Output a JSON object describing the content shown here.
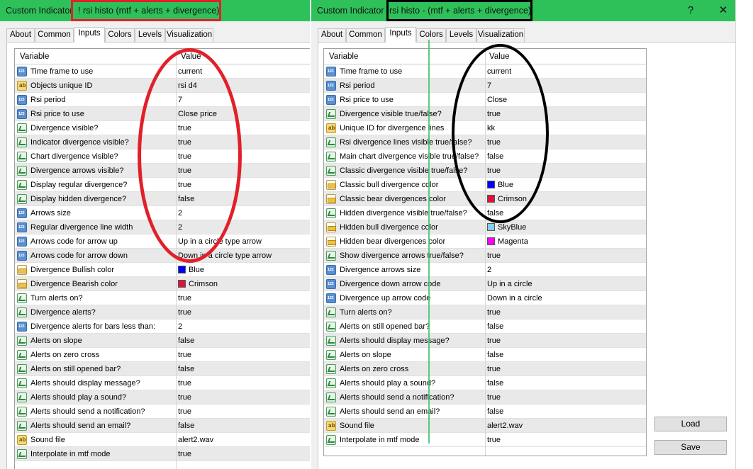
{
  "left": {
    "title_prefix": "Custom Indicator",
    "title_name": "! rsi histo (mtf + alerts + divergence)",
    "tabs": [
      "About",
      "Common",
      "Inputs",
      "Colors",
      "Levels",
      "Visualization"
    ],
    "header": {
      "variable": "Variable",
      "value": "Value"
    },
    "rows": [
      {
        "icon": "num",
        "variable": "Time frame to use",
        "value": "current"
      },
      {
        "icon": "str",
        "variable": "Objects unique ID",
        "value": "rsi d4"
      },
      {
        "icon": "num",
        "variable": "Rsi period",
        "value": "7"
      },
      {
        "icon": "num",
        "variable": "Rsi price to use",
        "value": "Close price"
      },
      {
        "icon": "bool",
        "variable": "Divergence visible?",
        "value": "true"
      },
      {
        "icon": "bool",
        "variable": "Indicator divergence visible?",
        "value": "true"
      },
      {
        "icon": "bool",
        "variable": "Chart divergence visible?",
        "value": "true"
      },
      {
        "icon": "bool",
        "variable": "Divergence arrows visible?",
        "value": "true"
      },
      {
        "icon": "bool",
        "variable": "Display regular divergence?",
        "value": "true"
      },
      {
        "icon": "bool",
        "variable": "Display hidden divergence?",
        "value": "false"
      },
      {
        "icon": "num",
        "variable": "Arrows size",
        "value": "2"
      },
      {
        "icon": "num",
        "variable": "Regular divergence line width",
        "value": "2"
      },
      {
        "icon": "num",
        "variable": "Arrows code for arrow up",
        "value": "Up in a circle type arrow"
      },
      {
        "icon": "num",
        "variable": "Arrows code for arrow down",
        "value": "Down in a circle type arrow"
      },
      {
        "icon": "col",
        "variable": "Divergence Bullish color",
        "value": "Blue",
        "swatch": "#0000ff"
      },
      {
        "icon": "col",
        "variable": "Divergence Bearish color",
        "value": "Crimson",
        "swatch": "#dc143c"
      },
      {
        "icon": "bool",
        "variable": "Turn alerts on?",
        "value": "true"
      },
      {
        "icon": "bool",
        "variable": "Divergence alerts?",
        "value": "true"
      },
      {
        "icon": "num",
        "variable": "Divergence alerts for bars less than:",
        "value": "2"
      },
      {
        "icon": "bool",
        "variable": "Alerts on slope",
        "value": "false"
      },
      {
        "icon": "bool",
        "variable": "Alerts on zero cross",
        "value": "true"
      },
      {
        "icon": "bool",
        "variable": "Alerts on still opened bar?",
        "value": "false"
      },
      {
        "icon": "bool",
        "variable": "Alerts should display message?",
        "value": "true"
      },
      {
        "icon": "bool",
        "variable": "Alerts should play a sound?",
        "value": "true"
      },
      {
        "icon": "bool",
        "variable": "Alerts should send a notification?",
        "value": "true"
      },
      {
        "icon": "bool",
        "variable": "Alerts should send an email?",
        "value": "false"
      },
      {
        "icon": "str",
        "variable": "Sound file",
        "value": "alert2.wav"
      },
      {
        "icon": "bool",
        "variable": "Interpolate in mtf mode",
        "value": "true"
      }
    ]
  },
  "right": {
    "title_prefix": "Custom Indicator",
    "title_name": "rsi histo - (mtf + alerts + divergence)",
    "help_label": "?",
    "close_label": "✕",
    "tabs": [
      "About",
      "Common",
      "Inputs",
      "Colors",
      "Levels",
      "Visualization"
    ],
    "header": {
      "variable": "Variable",
      "value": "Value"
    },
    "rows": [
      {
        "icon": "num",
        "variable": "Time frame to use",
        "value": "current"
      },
      {
        "icon": "num",
        "variable": "Rsi period",
        "value": "7"
      },
      {
        "icon": "num",
        "variable": "Rsi price to use",
        "value": "Close"
      },
      {
        "icon": "bool",
        "variable": "Divergence visible true/false?",
        "value": "true"
      },
      {
        "icon": "str",
        "variable": "Unique ID for divergence lines",
        "value": "kk"
      },
      {
        "icon": "bool",
        "variable": "Rsi divergence lines visible true/false?",
        "value": "true"
      },
      {
        "icon": "bool",
        "variable": "Main chart divergence visible true/false?",
        "value": "false"
      },
      {
        "icon": "bool",
        "variable": "Classic divergence visible true/false?",
        "value": "true"
      },
      {
        "icon": "col",
        "variable": "Classic bull divergence color",
        "value": "Blue",
        "swatch": "#0000ff"
      },
      {
        "icon": "col",
        "variable": "Classic bear divergences color",
        "value": "Crimson",
        "swatch": "#dc143c"
      },
      {
        "icon": "bool",
        "variable": "Hidden divergence visible true/false?",
        "value": "false"
      },
      {
        "icon": "col",
        "variable": "Hidden bull divergence color",
        "value": "SkyBlue",
        "swatch": "#87ceeb"
      },
      {
        "icon": "col",
        "variable": "Hidden bear divergences color",
        "value": "Magenta",
        "swatch": "#ff00ff"
      },
      {
        "icon": "bool",
        "variable": "Show divergence arrows true/false?",
        "value": "true"
      },
      {
        "icon": "num",
        "variable": "Divergence arrows size",
        "value": "2"
      },
      {
        "icon": "num",
        "variable": "Divergence down arrow code",
        "value": "Up in a circle"
      },
      {
        "icon": "num",
        "variable": "Divergence up arrow code",
        "value": "Down in a circle"
      },
      {
        "icon": "bool",
        "variable": "Turn alerts on?",
        "value": "true"
      },
      {
        "icon": "bool",
        "variable": "Alerts on still opened bar?",
        "value": "false"
      },
      {
        "icon": "bool",
        "variable": "Alerts should display message?",
        "value": "true"
      },
      {
        "icon": "bool",
        "variable": "Alerts on slope",
        "value": "false"
      },
      {
        "icon": "bool",
        "variable": "Alerts on zero cross",
        "value": "true"
      },
      {
        "icon": "bool",
        "variable": "Alerts should play a sound?",
        "value": "false"
      },
      {
        "icon": "bool",
        "variable": "Alerts should send a notification?",
        "value": "true"
      },
      {
        "icon": "bool",
        "variable": "Alerts should send an email?",
        "value": "false"
      },
      {
        "icon": "str",
        "variable": "Sound file",
        "value": "alert2.wav"
      },
      {
        "icon": "bool",
        "variable": "Interpolate in mtf mode",
        "value": "true"
      }
    ],
    "load_label": "Load",
    "save_label": "Save"
  },
  "colors": {
    "titlebar": "#2ec15a",
    "highlight_red": "#e1202a",
    "highlight_black": "#000000"
  }
}
